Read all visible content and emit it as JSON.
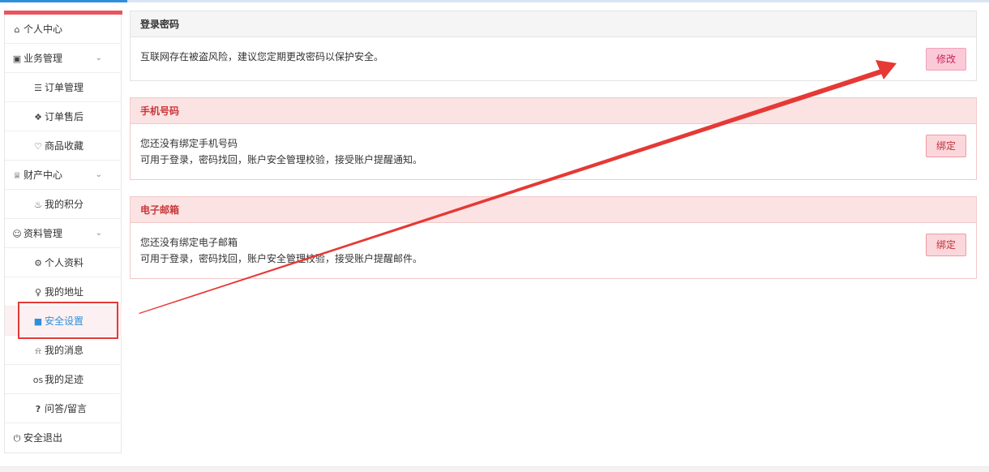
{
  "sidebar": {
    "items": [
      {
        "label": "个人中心",
        "icon": "home-icon",
        "level": "top"
      },
      {
        "label": "业务管理",
        "icon": "cube-icon",
        "level": "top",
        "expand": true
      },
      {
        "label": "订单管理",
        "icon": "list-icon",
        "level": "sub"
      },
      {
        "label": "订单售后",
        "icon": "puzzle-icon",
        "level": "sub"
      },
      {
        "label": "商品收藏",
        "icon": "heart-icon",
        "level": "sub"
      },
      {
        "label": "财产中心",
        "icon": "trophy-icon",
        "level": "top",
        "expand": true
      },
      {
        "label": "我的积分",
        "icon": "fire-icon",
        "level": "sub"
      },
      {
        "label": "资料管理",
        "icon": "user-icon",
        "level": "top",
        "expand": true
      },
      {
        "label": "个人资料",
        "icon": "gear-icon",
        "level": "sub"
      },
      {
        "label": "我的地址",
        "icon": "microphone-icon",
        "level": "sub"
      },
      {
        "label": "安全设置",
        "icon": "lock-icon",
        "level": "sub",
        "active": true
      },
      {
        "label": "我的消息",
        "icon": "bell-icon",
        "level": "sub"
      },
      {
        "label": "我的足迹",
        "icon": "os-icon",
        "level": "sub"
      },
      {
        "label": "问答/留言",
        "icon": "question-icon",
        "level": "sub"
      },
      {
        "label": "安全退出",
        "icon": "power-icon",
        "level": "top"
      }
    ]
  },
  "panels": {
    "password": {
      "title": "登录密码",
      "desc": "互联网存在被盗风险，建议您定期更改密码以保护安全。",
      "button": "修改"
    },
    "phone": {
      "title": "手机号码",
      "desc1": "您还没有绑定手机号码",
      "desc2": "可用于登录，密码找回，账户安全管理校验，接受账户提醒通知。",
      "button": "绑定"
    },
    "email": {
      "title": "电子邮箱",
      "desc1": "您还没有绑定电子邮箱",
      "desc2": "可用于登录，密码找回，账户安全管理校验，接受账户提醒邮件。",
      "button": "绑定"
    }
  },
  "colors": {
    "accent_blue": "#2f8fdb",
    "sidebar_red": "#e8565f",
    "annotation_red": "#e53935",
    "danger_header": "#fbe3e3"
  }
}
